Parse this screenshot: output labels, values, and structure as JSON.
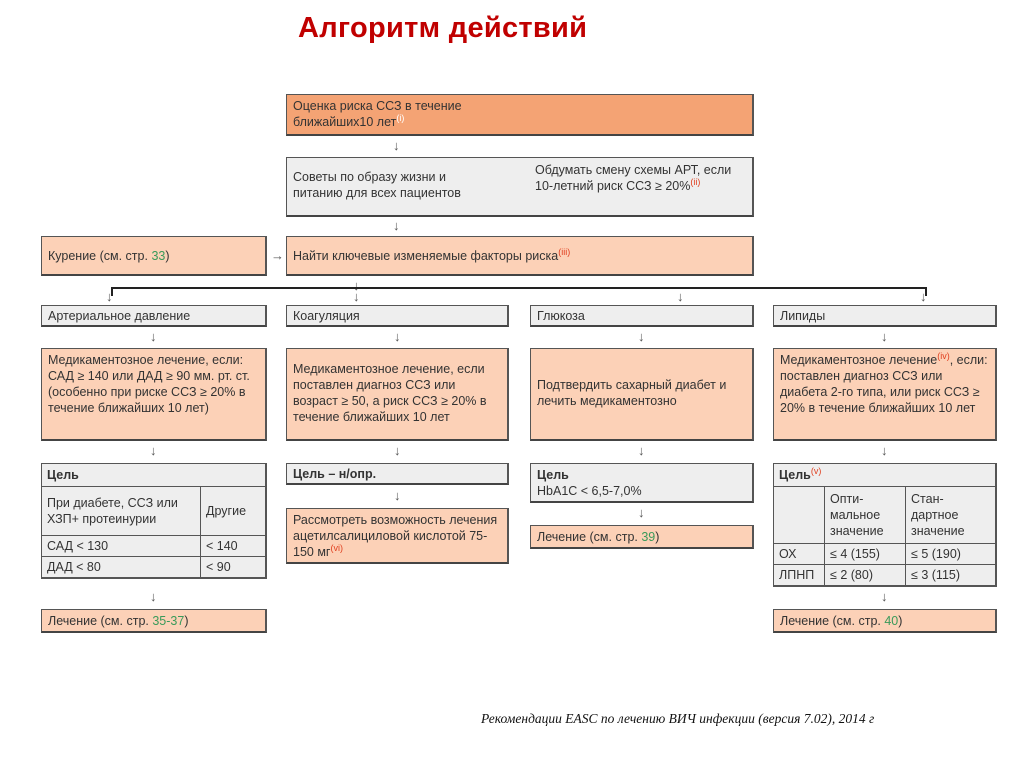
{
  "title": "Алгоритм действий",
  "footer": "Рекомендации EASC по лечению ВИЧ инфекции (версия 7.02), 2014 г",
  "colors": {
    "title": "#c00000",
    "box_dark_orange": "#f4a374",
    "box_orange": "#fcd1b7",
    "box_gray": "#eeeeee",
    "reference_link": "#3a9a5a",
    "footnote_marker": "#e04020"
  },
  "top": {
    "risk_assessment": {
      "text_line1": "Оценка риска ССЗ в течение",
      "text_line2": "ближайших10 лет",
      "note": "(i)"
    },
    "advice": {
      "left": "Советы по образу жизни и питанию для всех пациентов",
      "right": "Обдумать смену схемы АРТ, если 10-летний риск ССЗ ≥ 20%",
      "note": "(ii)"
    },
    "smoking": {
      "text": "Курение (см. стр. ",
      "page": "33",
      "close": ")"
    },
    "key_factors": {
      "text": "Найти ключевые изменяемые факторы риска",
      "note": "(iii)"
    }
  },
  "columns": {
    "bp": {
      "header": "Артериальное давление",
      "treatment": "Медикаментозное лечение, если: САД ≥ 140 или ДАД ≥ 90 мм. рт. ст. (особенно при риске ССЗ ≥ 20% в течение ближайших 10 лет)",
      "goal_title": "Цель",
      "goal_table": {
        "headers": [
          "При диабете, ССЗ или ХЗП+ протеинурии",
          "Другие"
        ],
        "rows": [
          [
            "САД < 130",
            "< 140"
          ],
          [
            "ДАД < 80",
            "< 90"
          ]
        ]
      },
      "final": {
        "text": "Лечение (см. стр. ",
        "page": "35-37",
        "close": ")"
      }
    },
    "coag": {
      "header": "Коагуляция",
      "treatment": "Медикаментозное лечение, если поставлен диагноз ССЗ или возраст ≥ 50, а риск ССЗ ≥ 20% в течение ближайших 10 лет",
      "goal": "Цель – н/опр.",
      "final": {
        "text": "Рассмотреть возможность лечения ацетилсалициловой кислотой 75-150 мг",
        "note": "(vi)"
      }
    },
    "glucose": {
      "header": "Глюкоза",
      "treatment": "Подтвердить сахарный диабет и лечить медикаментозно",
      "goal_title": "Цель",
      "goal_value": "HbA1C < 6,5-7,0%",
      "final": {
        "text": "Лечение (см. стр. ",
        "page": "39",
        "close": ")"
      }
    },
    "lipids": {
      "header": "Липиды",
      "treatment_start": "Медикаментозное лечение",
      "treatment_note": "(iv)",
      "treatment_rest": ", если: поставлен диагноз ССЗ или диабета 2-го типа, или риск ССЗ ≥ 20% в течение ближайших 10 лет",
      "goal_title": "Цель",
      "goal_note": "(v)",
      "goal_table": {
        "headers": [
          "",
          "Опти-мальное значение",
          "Стан-дартное значение"
        ],
        "rows": [
          [
            "ОХ",
            "≤ 4 (155)",
            "≤ 5 (190)"
          ],
          [
            "ЛПНП",
            "≤ 2 (80)",
            "≤ 3 (115)"
          ]
        ]
      },
      "final": {
        "text": "Лечение (см. стр. ",
        "page": "40",
        "close": ")"
      }
    }
  },
  "arrow_down": "↓",
  "arrow_right": "→"
}
